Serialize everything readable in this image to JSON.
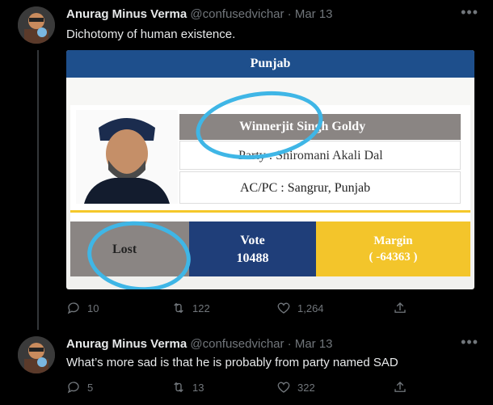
{
  "tweets": [
    {
      "author": {
        "name": "Anurag Minus Verma",
        "handle": "@confusedvichar"
      },
      "separator": "·",
      "date": "Mar 13",
      "text": "Dichotomy of human existence.",
      "media": {
        "header": "Punjab",
        "candidate_name": "Winnerjit Singh Goldy",
        "party": "Party : Shiromani Akali Dal",
        "constituency": "AC/PC : Sangrur, Punjab",
        "status": "Lost",
        "vote_label": "Vote",
        "vote_value": "10488",
        "margin_label": "Margin",
        "margin_value": "( -64363 )"
      },
      "actions": {
        "replies": "10",
        "retweets": "122",
        "likes": "1,264"
      }
    },
    {
      "author": {
        "name": "Anurag Minus Verma",
        "handle": "@confusedvichar"
      },
      "separator": "·",
      "date": "Mar 13",
      "text": "What’s more sad is that he is probably from party named SAD",
      "actions": {
        "replies": "5",
        "retweets": "13",
        "likes": "322"
      }
    }
  ],
  "icons": [
    "more-icon",
    "reply-icon",
    "retweet-icon",
    "like-icon",
    "share-icon"
  ],
  "colors": {
    "background": "#000000",
    "text": "#e7e9ea",
    "muted": "#71767b",
    "highlight_circle": "#3fb6e6"
  }
}
